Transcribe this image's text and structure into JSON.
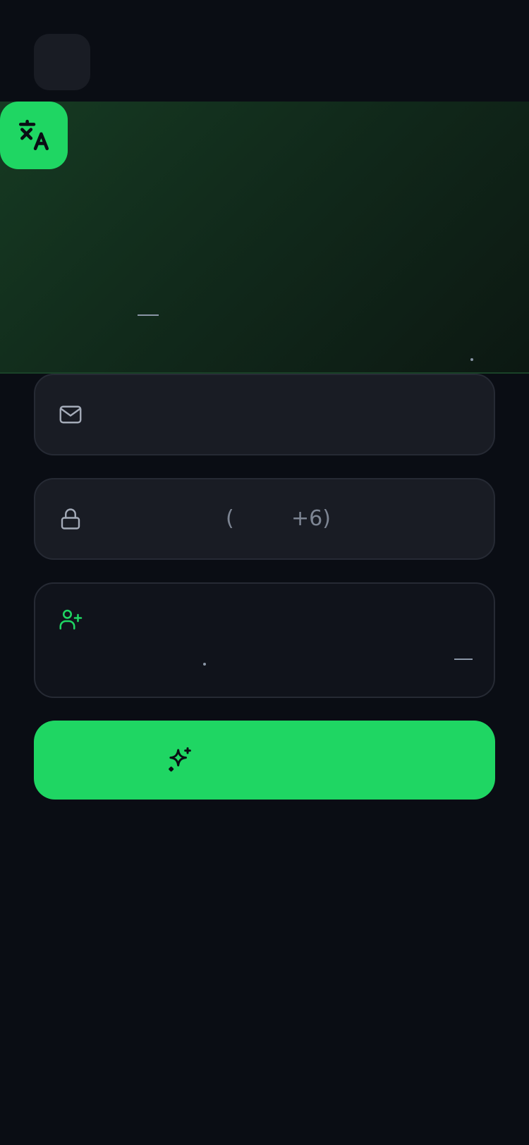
{
  "colors": {
    "background": "#0a0d14",
    "surface": "#191c24",
    "accent": "#1fd663",
    "muted_text": "#7d8593"
  },
  "header": {
    "back_button_icon": "back-icon"
  },
  "hero": {
    "logo_icon": "translate-icon"
  },
  "form": {
    "email": {
      "icon": "mail-icon"
    },
    "password": {
      "icon": "lock-icon",
      "hint_open": "(",
      "hint_count": "+6)"
    },
    "invite": {
      "icon": "user-plus-icon"
    },
    "submit": {
      "icon": "sparkles-icon"
    }
  }
}
